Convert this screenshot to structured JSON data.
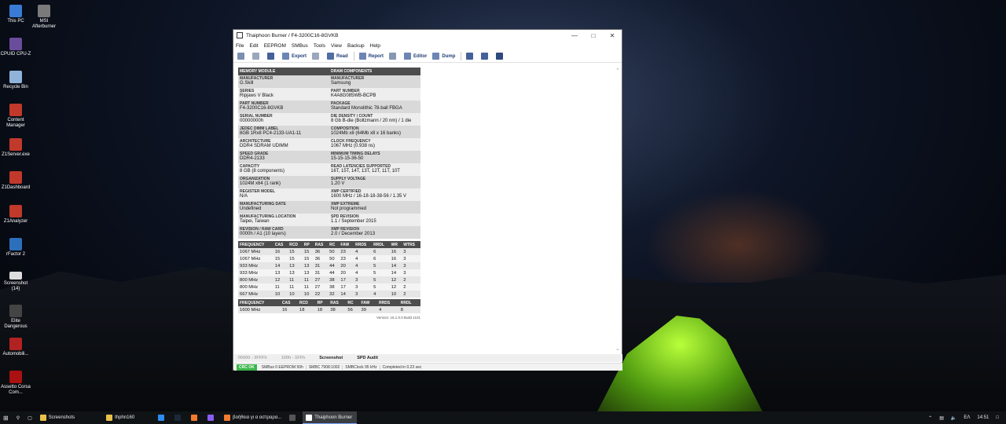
{
  "desktop": {
    "icons": [
      {
        "label": "This PC",
        "color": "#3a7bd5"
      },
      {
        "label": "MSI Afterburner",
        "color": "#7a7a7a"
      },
      {
        "label": "CPUID CPU-Z",
        "color": "#6a4c9c"
      },
      {
        "label": "Recycle Bin",
        "color": "#8fb3d9"
      },
      {
        "label": "Content Manager",
        "color": "#c0392b"
      },
      {
        "label": "Z1Server.exe",
        "color": "#c0392b"
      },
      {
        "label": "Z1Dashboard",
        "color": "#c0392b"
      },
      {
        "label": "Z1Analyzer",
        "color": "#c0392b"
      },
      {
        "label": "rFactor 2",
        "color": "#2c6fbb"
      },
      {
        "label": "Screenshot (14)",
        "color": "#dddddd"
      },
      {
        "label": "Elite Dangerous",
        "color": "#444444"
      },
      {
        "label": "Automobili...",
        "color": "#b22222"
      },
      {
        "label": "Assetto Corsa Com...",
        "color": "#aa1111"
      }
    ]
  },
  "window": {
    "title": "Thaiphoon Burner / F4-3200C16-8GVKB",
    "menu": [
      "File",
      "Edit",
      "EEPROM",
      "SMBus",
      "Tools",
      "View",
      "Backup",
      "Help"
    ],
    "toolbar": {
      "export": "Export",
      "read": "Read",
      "report": "Report",
      "editor": "Editor",
      "dump": "Dump"
    },
    "spec": {
      "header_left": "MEMORY MODULE",
      "header_right": "DRAM COMPONENTS",
      "rows": [
        {
          "l_label": "MANUFACTURER",
          "l_value": "G.Skill",
          "r_label": "MANUFACTURER",
          "r_value": "Samsung"
        },
        {
          "l_label": "SERIES",
          "l_value": "Ripjaws V Black",
          "r_label": "PART NUMBER",
          "r_value": "K4A8G085WB-BCPB"
        },
        {
          "l_label": "PART NUMBER",
          "l_value": "F4-3200C16-8GVKB",
          "r_label": "PACKAGE",
          "r_value": "Standard Monolithic 78-ball FBGA"
        },
        {
          "l_label": "SERIAL NUMBER",
          "l_value": "00000000h",
          "r_label": "DIE DENSITY / COUNT",
          "r_value": "8 Gb B-die (Boltzmann / 20 nm) / 1 die"
        },
        {
          "l_label": "JEDEC DIMM LABEL",
          "l_value": "8GB 1Rx8 PC4-2133-UA1-11",
          "r_label": "COMPOSITION",
          "r_value": "1024Mb x8 (64Mb x8 x 16 banks)"
        },
        {
          "l_label": "ARCHITECTURE",
          "l_value": "DDR4 SDRAM UDIMM",
          "r_label": "CLOCK FREQUENCY",
          "r_value": "1067 MHz (0.938 ns)"
        },
        {
          "l_label": "SPEED GRADE",
          "l_value": "DDR4-2133",
          "r_label": "MINIMUM TIMING DELAYS",
          "r_value": "15-15-15-36-50"
        },
        {
          "l_label": "CAPACITY",
          "l_value": "8 GB (8 components)",
          "r_label": "READ LATENCIES SUPPORTED",
          "r_value": "16T, 15T, 14T, 13T, 12T, 11T, 10T"
        },
        {
          "l_label": "ORGANIZATION",
          "l_value": "1024M x64 (1 rank)",
          "r_label": "SUPPLY VOLTAGE",
          "r_value": "1.20 V"
        },
        {
          "l_label": "REGISTER MODEL",
          "l_value": "N/A",
          "r_label": "XMP CERTIFIED",
          "r_value": "1600 MHz / 16-18-18-38-56 / 1.35 V"
        },
        {
          "l_label": "MANUFACTURING DATE",
          "l_value": "Undefined",
          "r_label": "XMP EXTREME",
          "r_value": "Not programmed"
        },
        {
          "l_label": "MANUFACTURING LOCATION",
          "l_value": "Taipei, Taiwan",
          "r_label": "SPD REVISION",
          "r_value": "1.1 / September 2015"
        },
        {
          "l_label": "REVISION / RAW CARD",
          "l_value": "0000h / A1 (10 layers)",
          "r_label": "XMP REVISION",
          "r_value": "2.0 / December 2013"
        }
      ]
    },
    "jedec_timings": {
      "headers": [
        "FREQUENCY",
        "CAS",
        "RCD",
        "RP",
        "RAS",
        "RC",
        "FAW",
        "RRDS",
        "RRDL",
        "WR",
        "WTRS"
      ],
      "rows": [
        [
          "1067 MHz",
          "16",
          "15",
          "15",
          "36",
          "50",
          "23",
          "4",
          "6",
          "16",
          "3"
        ],
        [
          "1067 MHz",
          "15",
          "15",
          "15",
          "36",
          "50",
          "23",
          "4",
          "6",
          "16",
          "3"
        ],
        [
          "933 MHz",
          "14",
          "13",
          "13",
          "31",
          "44",
          "20",
          "4",
          "5",
          "14",
          "3"
        ],
        [
          "933 MHz",
          "13",
          "13",
          "13",
          "31",
          "44",
          "20",
          "4",
          "5",
          "14",
          "3"
        ],
        [
          "800 MHz",
          "12",
          "11",
          "11",
          "27",
          "38",
          "17",
          "3",
          "5",
          "12",
          "2"
        ],
        [
          "800 MHz",
          "11",
          "11",
          "11",
          "27",
          "38",
          "17",
          "3",
          "5",
          "12",
          "2"
        ],
        [
          "667 MHz",
          "10",
          "10",
          "10",
          "22",
          "32",
          "14",
          "3",
          "4",
          "10",
          "2"
        ]
      ]
    },
    "xmp_timings": {
      "headers": [
        "FREQUENCY",
        "CAS",
        "RCD",
        "RP",
        "RAS",
        "RC",
        "FAW",
        "RRDS",
        "RRDL"
      ],
      "rows": [
        [
          "1600 MHz",
          "16",
          "18",
          "18",
          "38",
          "56",
          "39",
          "4",
          "8"
        ]
      ]
    },
    "version": "Version: 16.1.0.0 Build 1101",
    "bottom_tabs": [
      "00000 - 3FFFh",
      "100h - 1FFh",
      "Screenshot",
      "SPD Audit"
    ],
    "status": {
      "crc": "CRC OK",
      "fields": [
        "SMBus 0 EEPROM 50h",
        "SMBC 7908:1002",
        "SMBClock 95 kHz",
        "Completed in 0.23 sec"
      ]
    }
  },
  "taskbar": {
    "items": [
      {
        "label": "Screenshots",
        "color": "#e8c04a",
        "active": false
      },
      {
        "label": "thphn160",
        "color": "#e8c04a",
        "active": false
      },
      {
        "label": "βοήθεια γι α αστραρα...",
        "color": "#f27b2f",
        "active": false
      },
      {
        "label": "Thaiphoon Burner",
        "color": "#ffffff",
        "active": true
      }
    ],
    "tray": {
      "lang": "ΕΛ",
      "time": "14:51"
    }
  }
}
